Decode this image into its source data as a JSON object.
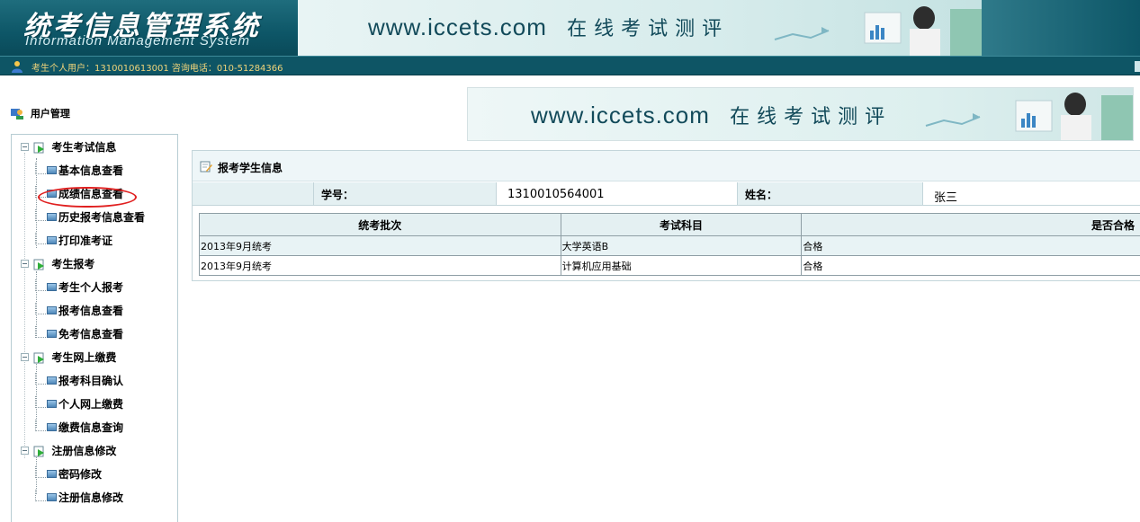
{
  "header": {
    "title_zh": "统考信息管理系统",
    "title_en": "Information Management System",
    "banner_url": "www.iccets.com",
    "banner_slogan": "在线考试测评"
  },
  "status_bar": {
    "icon": "user-icon",
    "label": "考生个人用户：",
    "user_id": "1310010613001",
    "hotline_label": "咨询电话：",
    "hotline": "010-51284366"
  },
  "sidebar": {
    "section_title": "用户管理",
    "section_icon": "user-management-icon",
    "groups": [
      {
        "label": "考生考试信息",
        "items": [
          {
            "label": "基本信息查看"
          },
          {
            "label": "成绩信息查看",
            "selected": true
          },
          {
            "label": "历史报考信息查看"
          },
          {
            "label": "打印准考证"
          }
        ]
      },
      {
        "label": "考生报考",
        "items": [
          {
            "label": "考生个人报考"
          },
          {
            "label": "报考信息查看"
          },
          {
            "label": "免考信息查看"
          }
        ]
      },
      {
        "label": "考生网上缴费",
        "items": [
          {
            "label": "报考科目确认"
          },
          {
            "label": "个人网上缴费"
          },
          {
            "label": "缴费信息查询"
          }
        ]
      },
      {
        "label": "注册信息修改",
        "items": [
          {
            "label": "密码修改"
          },
          {
            "label": "注册信息修改"
          }
        ]
      }
    ]
  },
  "content": {
    "banner_url": "www.iccets.com",
    "banner_slogan": "在线考试测评",
    "panel_title": "报考学生信息",
    "student_id_label": "学号：",
    "student_id": "1310010564001",
    "name_label": "姓名：",
    "name": "张三",
    "table": {
      "headers": [
        "统考批次",
        "考试科目",
        "是否合格"
      ],
      "rows": [
        [
          "2013年9月统考",
          "大学英语B",
          "合格"
        ],
        [
          "2013年9月统考",
          "计算机应用基础",
          "合格"
        ]
      ]
    }
  },
  "colors": {
    "header_bg": "#0d5667",
    "status_text": "#f0d47a",
    "panel_header_bg": "#eef6f8",
    "label_cell_bg": "#e4f0f2",
    "selected_ring": "#e02020"
  }
}
